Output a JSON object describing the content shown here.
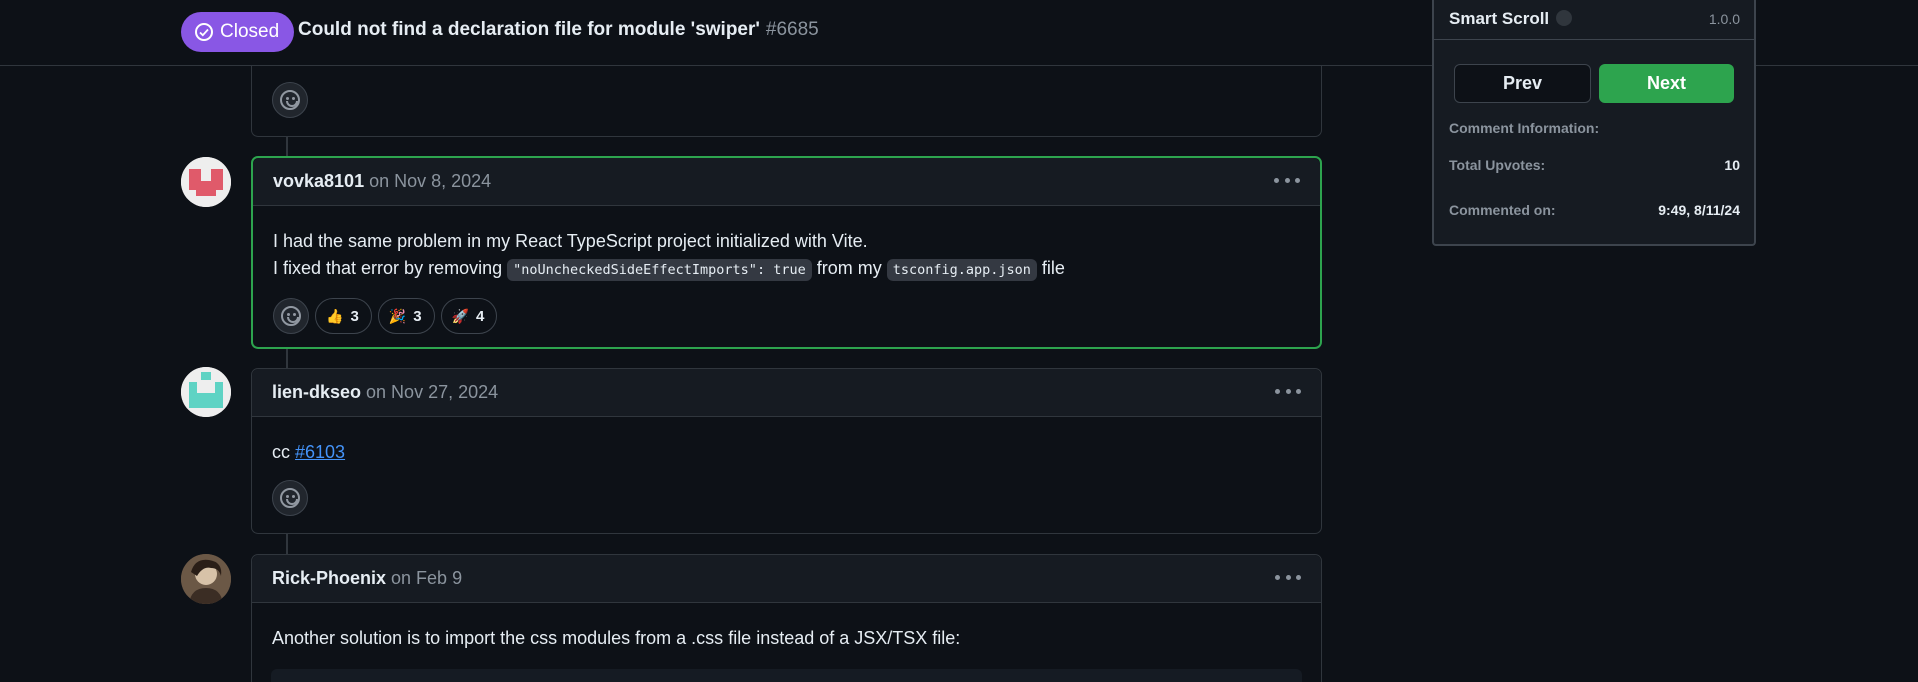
{
  "header": {
    "state_label": "Closed",
    "title": "Could not find a declaration file for module 'swiper'",
    "number": "#6685",
    "state_color": "#8957e5"
  },
  "comments": [
    {
      "author": "vovka8101",
      "date": "on Nov 8, 2024",
      "line1": "I had the same problem in my React TypeScript project initialized with Vite.",
      "line2_pre": "I fixed that error by removing ",
      "code1": "\"noUncheckedSideEffectImports\": true",
      "line2_mid": " from my ",
      "code2": "tsconfig.app.json",
      "line2_post": " file",
      "reactions": [
        {
          "emoji": "👍",
          "icon": "thumbs-up-icon",
          "count": "3"
        },
        {
          "emoji": "🎉",
          "icon": "party-popper-icon",
          "count": "3"
        },
        {
          "emoji": "🚀",
          "icon": "rocket-icon",
          "count": "4"
        }
      ]
    },
    {
      "author": "lien-dkseo",
      "date": "on Nov 27, 2024",
      "text_pre": "cc ",
      "link": "#6103"
    },
    {
      "author": "Rick-Phoenix",
      "date": "on Feb 9",
      "text": "Another solution is to import the css modules from a .css file instead of a JSX/TSX file:"
    }
  ],
  "smart_scroll": {
    "title": "Smart Scroll",
    "version": "1.0.0",
    "prev_label": "Prev",
    "next_label": "Next",
    "info_label": "Comment Information:",
    "upvotes_label": "Total Upvotes:",
    "upvotes_value": "10",
    "commented_label": "Commented on:",
    "commented_value": "9:49, 8/11/24"
  },
  "colors": {
    "background": "#0d1117",
    "highlight_border": "#2da44e",
    "link": "#4493f8",
    "closed_badge": "#8957e5"
  }
}
